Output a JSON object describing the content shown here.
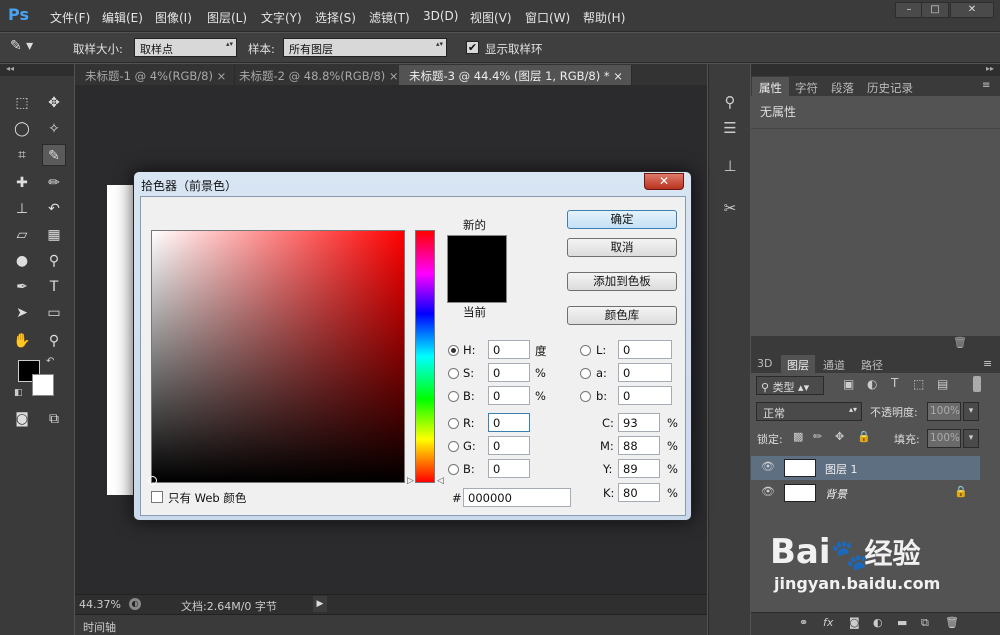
{
  "app": {
    "logo": "Ps"
  },
  "menu": [
    "文件(F)",
    "编辑(E)",
    "图像(I)",
    "图层(L)",
    "文字(Y)",
    "选择(S)",
    "滤镜(T)",
    "3D(D)",
    "视图(V)",
    "窗口(W)",
    "帮助(H)"
  ],
  "window_controls": {
    "minimize": "–",
    "maximize": "□",
    "close": "✕"
  },
  "options_bar": {
    "tool_icon": "eyedropper-icon",
    "sample_size_label": "取样大小:",
    "sample_size_value": "取样点",
    "sample_label": "样本:",
    "sample_value": "所有图层",
    "show_ring_label": "显示取样环",
    "show_ring_checked": true
  },
  "doc_tabs": [
    {
      "label": "未标题-1 @ 4%(RGB/8)",
      "close": "×",
      "active": false
    },
    {
      "label": "未标题-2 @ 48.8%(RGB/8)",
      "close": "×",
      "active": false
    },
    {
      "label": "未标题-3 @ 44.4% (图层 1, RGB/8) *",
      "close": "×",
      "active": true
    }
  ],
  "status_bar": {
    "zoom": "44.37%",
    "doc_info": "文档:2.64M/0 字节"
  },
  "timeline_label": "时间轴",
  "properties_panel": {
    "tabs": [
      "属性",
      "字符",
      "段落",
      "历史记录"
    ],
    "active_tab": "属性",
    "body_text": "无属性"
  },
  "layers_panel": {
    "tabs": [
      "3D",
      "图层",
      "通道",
      "路径"
    ],
    "active_tab": "图层",
    "filter_label": "类型",
    "blend_mode": "正常",
    "opacity_label": "不透明度:",
    "opacity_value": "100%",
    "lock_label": "锁定:",
    "fill_label": "填充:",
    "fill_value": "100%",
    "layers": [
      {
        "name": "图层 1",
        "selected": true,
        "locked": false
      },
      {
        "name": "背景",
        "selected": false,
        "locked": true
      }
    ]
  },
  "color_picker": {
    "title": "拾色器（前景色）",
    "close": "✕",
    "new_label": "新的",
    "current_label": "当前",
    "new_color": "#000000",
    "current_color": "#000000",
    "buttons": {
      "ok": "确定",
      "cancel": "取消",
      "add_swatch": "添加到色板",
      "libraries": "颜色库"
    },
    "web_only_label": "只有 Web 颜色",
    "hsb": [
      {
        "label": "H:",
        "value": "0",
        "unit": "度"
      },
      {
        "label": "S:",
        "value": "0",
        "unit": "%"
      },
      {
        "label": "B:",
        "value": "0",
        "unit": "%"
      }
    ],
    "rgb": [
      {
        "label": "R:",
        "value": "0"
      },
      {
        "label": "G:",
        "value": "0"
      },
      {
        "label": "B:",
        "value": "0"
      }
    ],
    "lab": [
      {
        "label": "L:",
        "value": "0"
      },
      {
        "label": "a:",
        "value": "0"
      },
      {
        "label": "b:",
        "value": "0"
      }
    ],
    "cmyk": [
      {
        "label": "C:",
        "value": "93",
        "unit": "%"
      },
      {
        "label": "M:",
        "value": "88",
        "unit": "%"
      },
      {
        "label": "Y:",
        "value": "89",
        "unit": "%"
      },
      {
        "label": "K:",
        "value": "80",
        "unit": "%"
      }
    ],
    "hex_label": "#",
    "hex_value": "000000"
  },
  "watermark": {
    "brand": "Bai",
    "brand_cn": "经验",
    "url": "jingyan.baidu.com"
  }
}
